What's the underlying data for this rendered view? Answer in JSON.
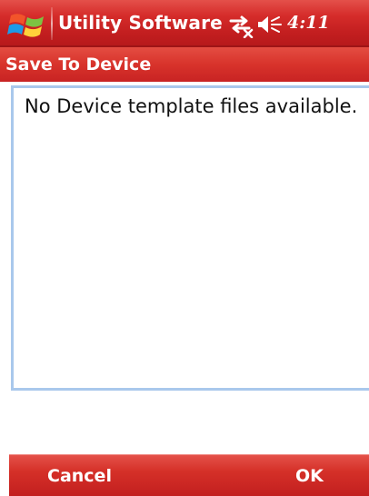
{
  "title_bar": {
    "app_title": "Utility Software",
    "time": "4:11",
    "icons": {
      "start": "windows-start-icon",
      "connectivity": "connectivity-icon",
      "volume": "volume-icon"
    },
    "colors": {
      "bar": "#d52c2a",
      "text": "#ffffff"
    }
  },
  "dialog": {
    "title": "Save To Device",
    "message": "No Device template files available.",
    "colors": {
      "header": "#d8332b",
      "border": "#a9c8ec"
    }
  },
  "softkeys": {
    "left": "Cancel",
    "right": "OK",
    "color": "#d53028"
  }
}
